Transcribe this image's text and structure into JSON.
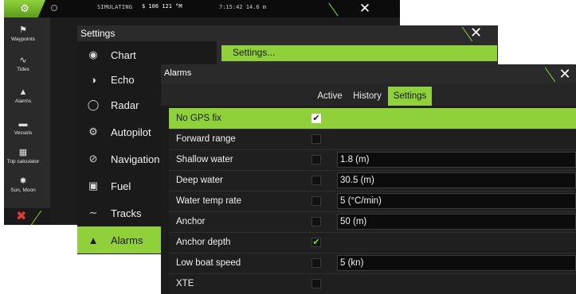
{
  "statusbar": {
    "simulating": "SIMULATING",
    "speed": "$ 106 121 °M",
    "time": "7:15:42   14.6 m",
    "close_glyph": "✕"
  },
  "sidebar": {
    "items": [
      {
        "label": "Waypoints",
        "icon": "flag-icon",
        "glyph": "⚑"
      },
      {
        "label": "Tides",
        "icon": "wave-icon",
        "glyph": "∿"
      },
      {
        "label": "Alarms",
        "icon": "bell-icon",
        "glyph": "▲"
      },
      {
        "label": "Vessels",
        "icon": "vessel-icon",
        "glyph": "▬"
      },
      {
        "label": "Trip calculator",
        "icon": "calculator-icon",
        "glyph": "▦"
      },
      {
        "label": "Sun, Moon",
        "icon": "sun-icon",
        "glyph": "✸"
      }
    ],
    "exit_glyph": "✖"
  },
  "settings": {
    "title": "Settings",
    "close_glyph": "✕",
    "selected_label": "Settings...",
    "menu": [
      {
        "label": "Chart",
        "icon": "chart-icon",
        "glyph": "◉"
      },
      {
        "label": "Echo",
        "icon": "echo-icon",
        "glyph": "◑"
      },
      {
        "label": "Radar",
        "icon": "radar-icon",
        "glyph": "◯"
      },
      {
        "label": "Autopilot",
        "icon": "autopilot-icon",
        "glyph": "⚙"
      },
      {
        "label": "Navigation",
        "icon": "navigation-icon",
        "glyph": "⊘"
      },
      {
        "label": "Fuel",
        "icon": "fuel-icon",
        "glyph": "▣"
      },
      {
        "label": "Tracks",
        "icon": "tracks-icon",
        "glyph": "∼"
      },
      {
        "label": "Alarms",
        "icon": "alarm-bell-icon",
        "glyph": "▲"
      }
    ]
  },
  "alarms": {
    "title": "Alarms",
    "close_glyph": "✕",
    "tabs": [
      "Active",
      "History",
      "Settings"
    ],
    "active_tab": "Settings",
    "check_glyph": "✔",
    "rows": [
      {
        "label": "No GPS fix",
        "checked": true,
        "value": ""
      },
      {
        "label": "Forward range",
        "checked": false,
        "value": ""
      },
      {
        "label": "Shallow water",
        "checked": false,
        "value": "1.8 (m)"
      },
      {
        "label": "Deep water",
        "checked": false,
        "value": "30.5 (m)"
      },
      {
        "label": "Water temp rate",
        "checked": false,
        "value": "5 (°C/min)"
      },
      {
        "label": "Anchor",
        "checked": false,
        "value": "50 (m)"
      },
      {
        "label": "Anchor depth",
        "checked": true,
        "value": ""
      },
      {
        "label": "Low boat speed",
        "checked": false,
        "value": "5 (kn)"
      },
      {
        "label": "XTE",
        "checked": false,
        "value": ""
      }
    ]
  },
  "colors": {
    "accent": "#8fd03b",
    "window_bg": "#1f1f1f",
    "danger": "#e23b3b"
  }
}
